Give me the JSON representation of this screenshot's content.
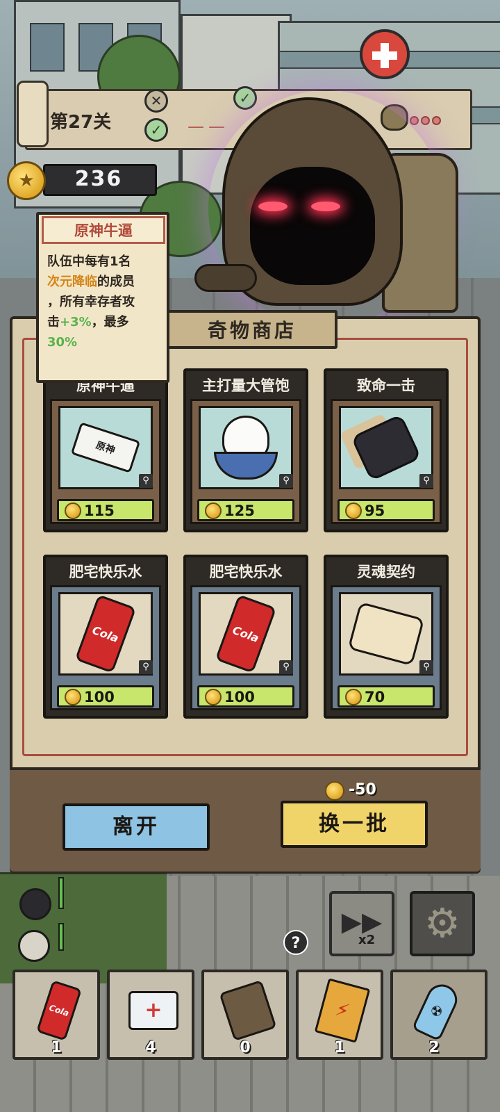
{
  "level": {
    "title": "第27关"
  },
  "coins": {
    "value": "236"
  },
  "tooltip": {
    "title": "原神牛逼",
    "line1": "队伍中每有1名",
    "highlight": "次元降临",
    "line2": "的成员",
    "line3": "，所有幸存者攻",
    "line4a": "击",
    "bonus": "+3%",
    "line4b": "，最多",
    "max": "30%"
  },
  "shop": {
    "title": "奇物商店",
    "items": [
      {
        "name": "原神牛逼",
        "price": "115",
        "icon": "genshin-ticket-icon",
        "art_text": "原神"
      },
      {
        "name": "主打量大管饱",
        "price": "125",
        "icon": "rice-bowl-icon"
      },
      {
        "name": "致命一击",
        "price": "95",
        "icon": "glove-icon"
      },
      {
        "name": "肥宅快乐水",
        "price": "100",
        "icon": "cola-can-icon",
        "art_text": "Cola"
      },
      {
        "name": "肥宅快乐水",
        "price": "100",
        "icon": "cola-can-icon",
        "art_text": "Cola"
      },
      {
        "name": "灵魂契约",
        "price": "70",
        "icon": "contract-scroll-icon"
      }
    ],
    "leave_label": "离开",
    "refresh_label": "换一批",
    "refresh_cost": "-50"
  },
  "controls": {
    "speed_label": "x2",
    "help_label": "?"
  },
  "inventory": [
    {
      "icon": "cola-can-icon",
      "count": "1",
      "art_text": "Cola"
    },
    {
      "icon": "first-aid-kit-icon",
      "count": "4"
    },
    {
      "icon": "scroll-icon",
      "count": "0"
    },
    {
      "icon": "lightning-card-icon",
      "count": "1"
    },
    {
      "icon": "nuke-bomb-icon",
      "count": "2"
    }
  ],
  "colors": {
    "price_tag": "#c7e66b",
    "leave_button": "#8fc3e3",
    "refresh_button": "#f0d46a",
    "tooltip_highlight": "#d48416",
    "tooltip_bonus": "#59b34e"
  }
}
